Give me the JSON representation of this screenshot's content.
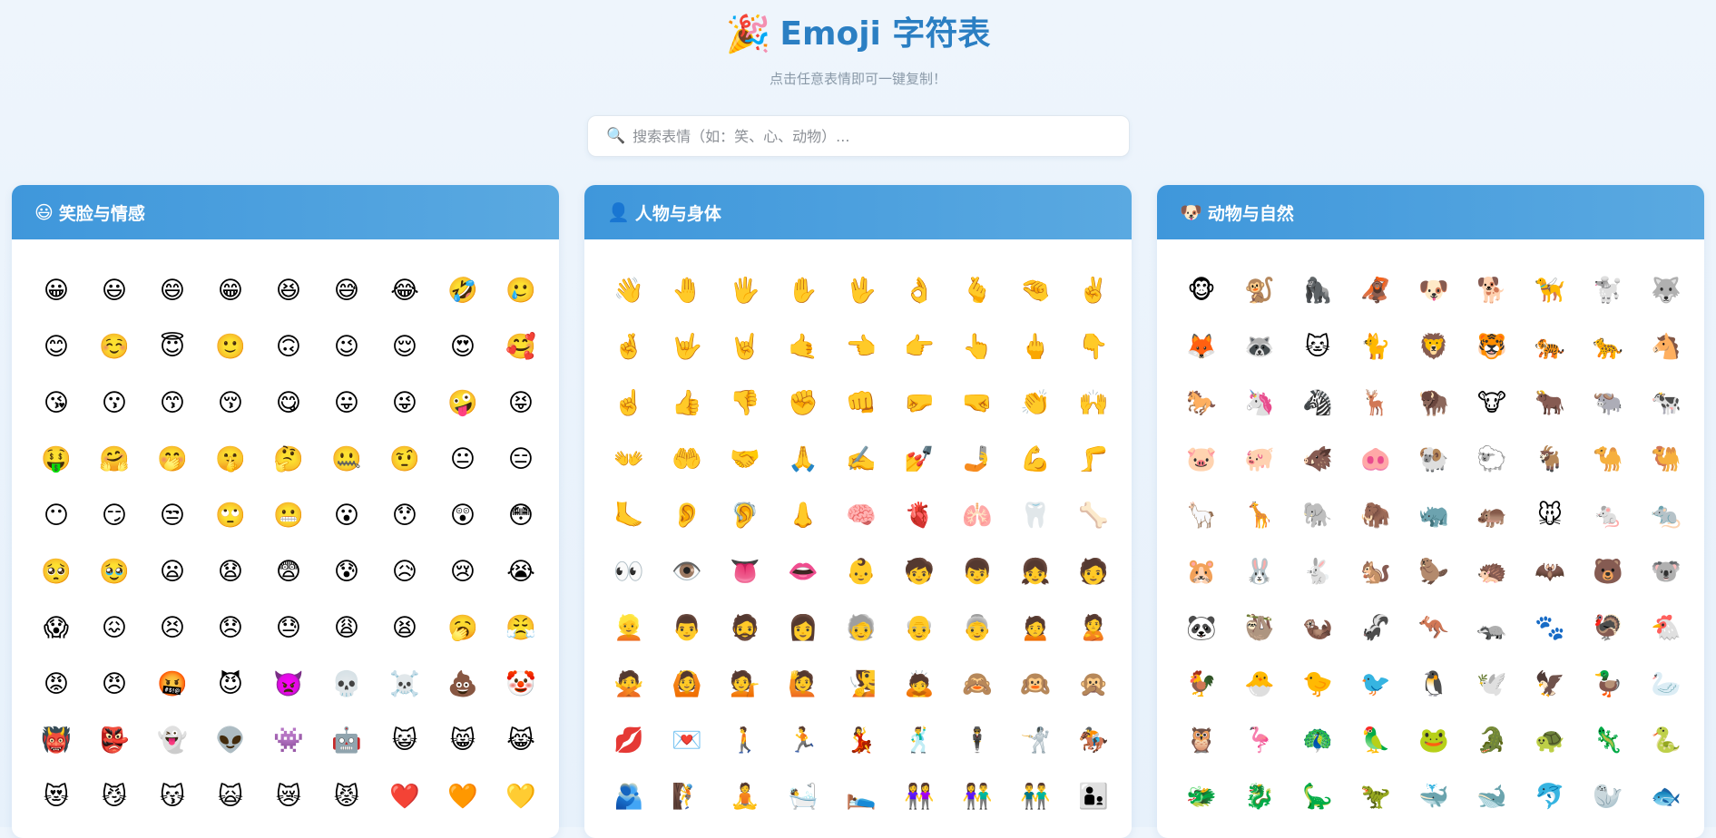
{
  "header": {
    "icon": "🎉",
    "title": "Emoji 字符表",
    "subtitle": "点击任意表情即可一键复制！"
  },
  "search": {
    "icon": "🔍",
    "placeholder": "搜索表情（如：笑、心、动物）..."
  },
  "panels": [
    {
      "icon": "😃",
      "title": "笑脸与情感",
      "emojis": [
        "😀",
        "😃",
        "😄",
        "😁",
        "😆",
        "😅",
        "😂",
        "🤣",
        "🥲",
        "😊",
        "☺️",
        "😇",
        "🙂",
        "🙃",
        "😉",
        "😌",
        "😍",
        "🥰",
        "😘",
        "😗",
        "😙",
        "😚",
        "😋",
        "😛",
        "😜",
        "🤪",
        "😝",
        "🤑",
        "🤗",
        "🤭",
        "🤫",
        "🤔",
        "🤐",
        "🤨",
        "😐",
        "😑",
        "😶",
        "😏",
        "😒",
        "🙄",
        "😬",
        "😮",
        "😯",
        "😲",
        "😳",
        "🥺",
        "🥹",
        "😦",
        "😧",
        "😨",
        "😰",
        "😥",
        "😢",
        "😭",
        "😱",
        "😖",
        "😣",
        "😞",
        "😓",
        "😩",
        "😫",
        "🥱",
        "😤",
        "😡",
        "😠",
        "🤬",
        "😈",
        "👿",
        "💀",
        "☠️",
        "💩",
        "🤡",
        "👹",
        "👺",
        "👻",
        "👽",
        "👾",
        "🤖",
        "😺",
        "😸",
        "😹",
        "😻",
        "😼",
        "😽",
        "🙀",
        "😿",
        "😾",
        "❤️",
        "🧡",
        "💛"
      ]
    },
    {
      "icon": "👤",
      "title": "人物与身体",
      "emojis": [
        "👋",
        "🤚",
        "🖐️",
        "✋",
        "🖖",
        "👌",
        "🫰",
        "🤏",
        "✌️",
        "🤞",
        "🤟",
        "🤘",
        "🤙",
        "👈",
        "👉",
        "👆",
        "🖕",
        "👇",
        "☝️",
        "👍",
        "👎",
        "✊",
        "👊",
        "🤛",
        "🤜",
        "👏",
        "🙌",
        "👐",
        "🤲",
        "🤝",
        "🙏",
        "✍️",
        "💅",
        "🤳",
        "💪",
        "🦵",
        "🦶",
        "👂",
        "🦻",
        "👃",
        "🧠",
        "🫀",
        "🫁",
        "🦷",
        "🦴",
        "👀",
        "👁️",
        "👅",
        "👄",
        "👶",
        "🧒",
        "👦",
        "👧",
        "🧑",
        "👱",
        "👨",
        "🧔",
        "👩",
        "🧓",
        "👴",
        "👵",
        "🙍",
        "🙎",
        "🙅",
        "🙆",
        "💁",
        "🙋",
        "🧏",
        "🙇",
        "🙈",
        "🙉",
        "🙊",
        "💋",
        "💌",
        "🚶",
        "🏃",
        "💃",
        "🕺",
        "🕴️",
        "🤺",
        "🏇",
        "🫂",
        "🧗",
        "🧘",
        "🛀",
        "🛌",
        "👭",
        "👫",
        "👬",
        "👨‍👦"
      ]
    },
    {
      "icon": "🐶",
      "title": "动物与自然",
      "emojis": [
        "🐵",
        "🐒",
        "🦍",
        "🦧",
        "🐶",
        "🐕",
        "🦮",
        "🐩",
        "🐺",
        "🦊",
        "🦝",
        "🐱",
        "🐈",
        "🦁",
        "🐯",
        "🐅",
        "🐆",
        "🐴",
        "🐎",
        "🦄",
        "🦓",
        "🦌",
        "🦬",
        "🐮",
        "🐂",
        "🐃",
        "🐄",
        "🐷",
        "🐖",
        "🐗",
        "🐽",
        "🐏",
        "🐑",
        "🐐",
        "🐪",
        "🐫",
        "🦙",
        "🦒",
        "🐘",
        "🦣",
        "🦏",
        "🦛",
        "🐭",
        "🐁",
        "🐀",
        "🐹",
        "🐰",
        "🐇",
        "🐿️",
        "🦫",
        "🦔",
        "🦇",
        "🐻",
        "🐨",
        "🐼",
        "🦥",
        "🦦",
        "🦨",
        "🦘",
        "🦡",
        "🐾",
        "🦃",
        "🐔",
        "🐓",
        "🐣",
        "🐤",
        "🐦",
        "🐧",
        "🕊️",
        "🦅",
        "🦆",
        "🦢",
        "🦉",
        "🦩",
        "🦚",
        "🦜",
        "🐸",
        "🐊",
        "🐢",
        "🦎",
        "🐍",
        "🐲",
        "🐉",
        "🦕",
        "🦖",
        "🐳",
        "🐋",
        "🐬",
        "🦭",
        "🐟"
      ]
    }
  ]
}
